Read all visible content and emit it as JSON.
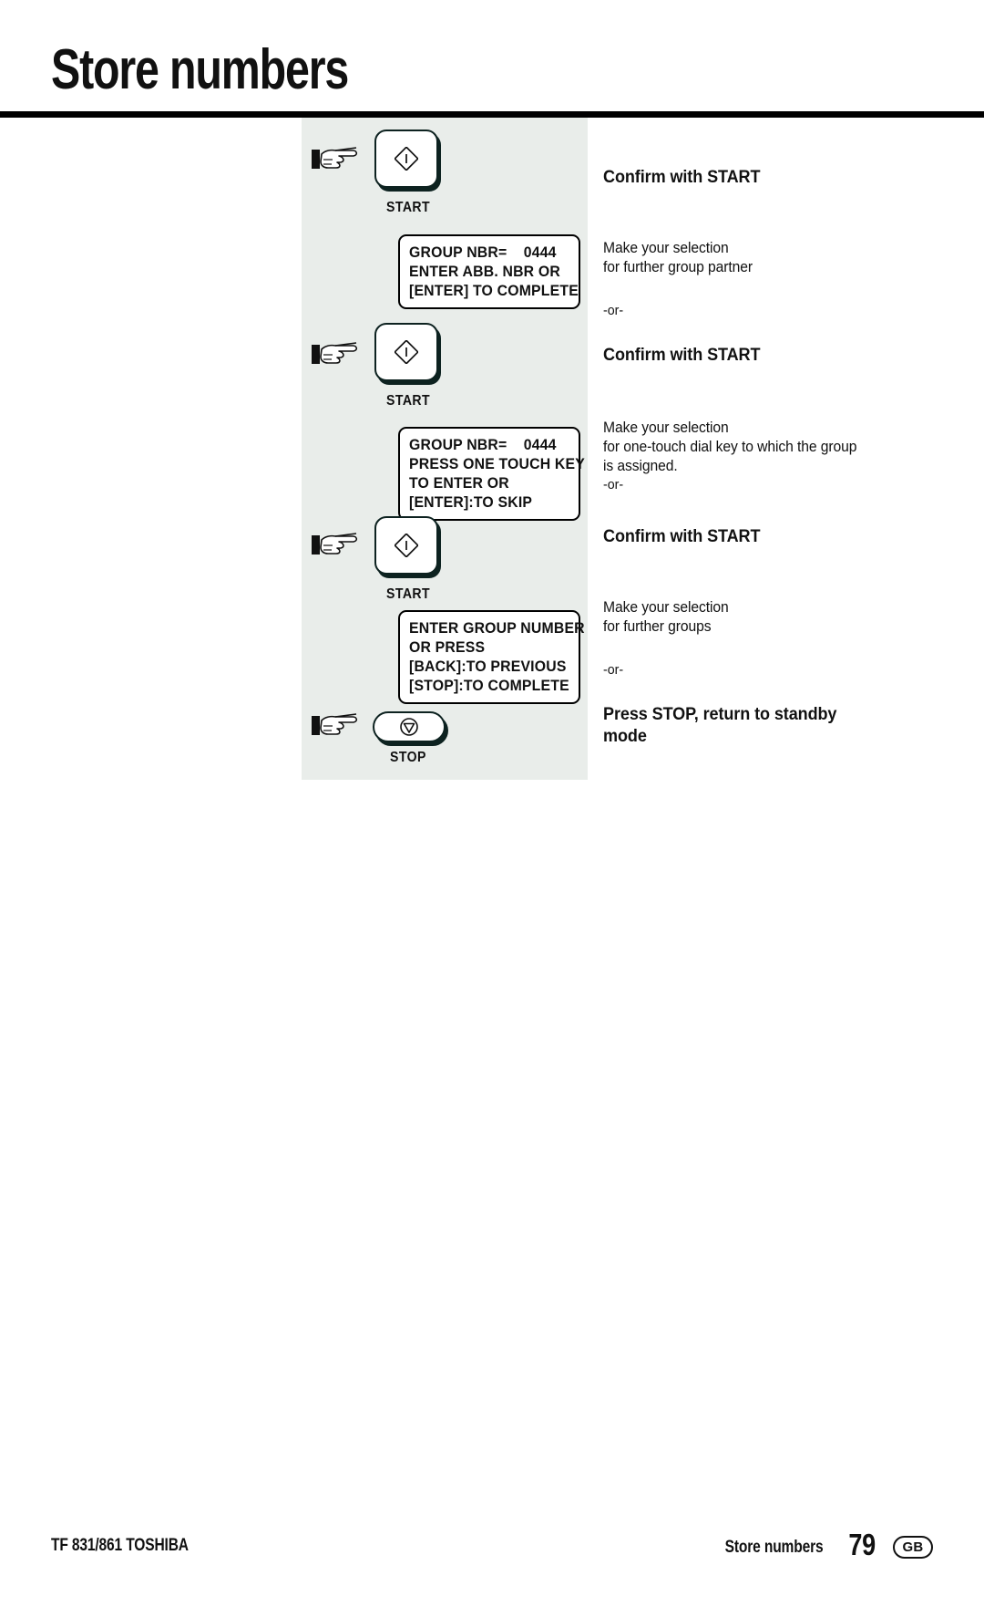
{
  "page": {
    "title": "Store numbers"
  },
  "flow": {
    "steps": [
      {
        "id": "start-1",
        "hand_icon": "hand-pointer-icon",
        "button": {
          "kind": "start",
          "glyph_icon": "start-diamond-icon",
          "caption": "START"
        },
        "note_head": "Confirm with START"
      },
      {
        "id": "lcd-1",
        "lcd_lines": [
          "GROUP NBR=    0444",
          "",
          "ENTER ABB. NBR OR",
          "[ENTER] TO COMPLETE"
        ],
        "note_body": [
          "Make your selection",
          "for further group partner"
        ],
        "note_or": "-or-"
      },
      {
        "id": "start-2",
        "hand_icon": "hand-pointer-icon",
        "button": {
          "kind": "start",
          "glyph_icon": "start-diamond-icon",
          "caption": "START"
        },
        "note_head": "Confirm with START"
      },
      {
        "id": "lcd-2",
        "lcd_lines": [
          "GROUP NBR=    0444",
          "PRESS ONE TOUCH KEY",
          "TO ENTER OR",
          "[ENTER]:TO SKIP"
        ],
        "note_body": [
          "Make your selection",
          "for one-touch dial key to which the group",
          "is assigned."
        ],
        "note_or": "-or-"
      },
      {
        "id": "start-3",
        "hand_icon": "hand-pointer-icon",
        "button": {
          "kind": "start",
          "glyph_icon": "start-diamond-icon",
          "caption": "START"
        },
        "note_head": "Confirm with START"
      },
      {
        "id": "lcd-3",
        "lcd_lines": [
          "ENTER GROUP NUMBER",
          "OR PRESS",
          "[BACK]:TO PREVIOUS",
          "[STOP]:TO COMPLETE"
        ],
        "note_body": [
          "Make your selection",
          "for further groups"
        ],
        "note_or": "-or-"
      },
      {
        "id": "stop-1",
        "hand_icon": "hand-pointer-icon",
        "button": {
          "kind": "stop",
          "glyph_icon": "stop-triangle-icon",
          "caption": "STOP"
        },
        "note_head_lines": [
          "Press STOP, return to standby",
          "mode"
        ]
      }
    ]
  },
  "footer": {
    "left": "TF 831/861 TOSHIBA",
    "section": "Store numbers",
    "page_number": "79",
    "language": "GB"
  },
  "colors": {
    "panel_background": "#e9edea",
    "ink": "#111111",
    "button_outline": "#0d2220",
    "page_background": "#ffffff"
  }
}
